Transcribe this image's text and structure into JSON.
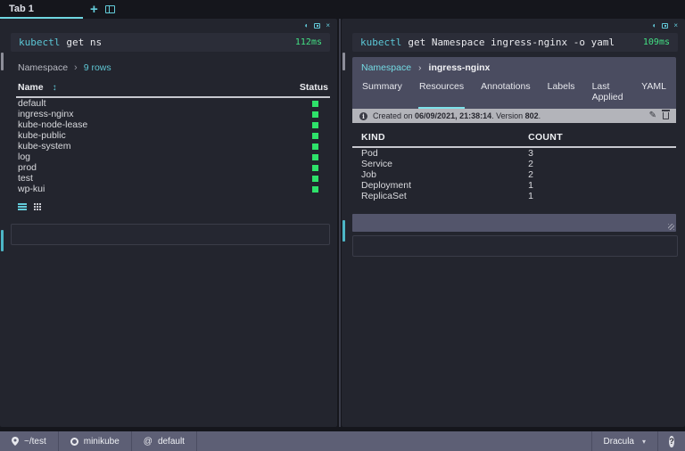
{
  "tab_bar": {
    "tab_label": "Tab 1"
  },
  "icons": {
    "new_tab": "+",
    "contrast": "◐",
    "close_split": "×",
    "sort": "↕",
    "breadcrumb_chevron": "›",
    "info": "i",
    "edit": "✎",
    "theme_caret": "▾",
    "at_namespace": "@",
    "help": "?"
  },
  "colors": {
    "accent_teal": "#63ccda",
    "status_green": "#2ee26a",
    "duration_green": "#43e084",
    "nav_bg": "#4a4c60",
    "banner_bg": "#b3b4ba",
    "statusbar_bg": "#5d5f75"
  },
  "left_pane": {
    "command": {
      "program": "kubectl",
      "args": "get ns",
      "duration": "112ms"
    },
    "breadcrumb": {
      "kind": "Namespace",
      "detail": "9 rows"
    },
    "table": {
      "columns": [
        "Name",
        "Status"
      ],
      "rows": [
        {
          "name": "default",
          "status": "ok"
        },
        {
          "name": "ingress-nginx",
          "status": "ok"
        },
        {
          "name": "kube-node-lease",
          "status": "ok"
        },
        {
          "name": "kube-public",
          "status": "ok"
        },
        {
          "name": "kube-system",
          "status": "ok"
        },
        {
          "name": "log",
          "status": "ok"
        },
        {
          "name": "prod",
          "status": "ok"
        },
        {
          "name": "test",
          "status": "ok"
        },
        {
          "name": "wp-kui",
          "status": "ok"
        }
      ]
    }
  },
  "right_pane": {
    "command": {
      "program": "kubectl",
      "args": "get Namespace ingress-nginx -o yaml",
      "duration": "109ms"
    },
    "breadcrumb": {
      "kind": "Namespace",
      "name": "ingress-nginx"
    },
    "tabs": [
      "Summary",
      "Resources",
      "Annotations",
      "Labels",
      "Last Applied",
      "YAML"
    ],
    "active_tab": "Resources",
    "banner": {
      "prefix": "Created on ",
      "timestamp": "06/09/2021, 21:38:14",
      "infix": ". Version ",
      "version": "802",
      "suffix": "."
    },
    "table": {
      "columns": [
        "KIND",
        "COUNT"
      ],
      "rows": [
        {
          "kind": "Pod",
          "count": "3"
        },
        {
          "kind": "Service",
          "count": "2"
        },
        {
          "kind": "Job",
          "count": "2"
        },
        {
          "kind": "Deployment",
          "count": "1"
        },
        {
          "kind": "ReplicaSet",
          "count": "1"
        }
      ]
    }
  },
  "status_bar": {
    "cwd": "~/test",
    "context": "minikube",
    "namespace": "default",
    "theme": "Dracula"
  }
}
